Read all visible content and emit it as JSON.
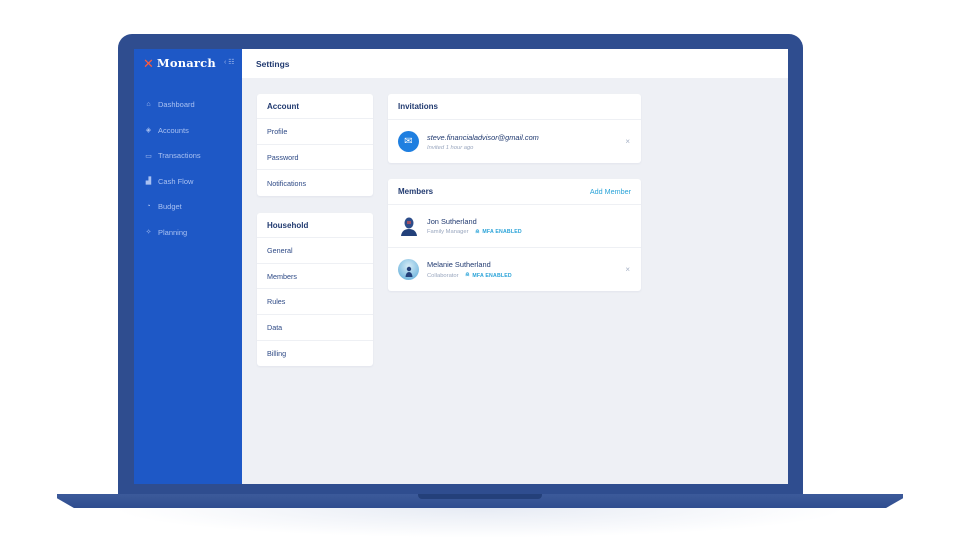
{
  "app": {
    "brand": "Monarch",
    "brand_logo_color": "#ff5a3c",
    "sidebar_color": "#1e58c6",
    "accent_color": "#2aa3d8"
  },
  "sidebar": {
    "collapse_icon": "collapse-icon",
    "items": [
      {
        "label": "Dashboard",
        "icon": "home-icon"
      },
      {
        "label": "Accounts",
        "icon": "layers-icon"
      },
      {
        "label": "Transactions",
        "icon": "card-icon"
      },
      {
        "label": "Cash Flow",
        "icon": "bar-chart-icon"
      },
      {
        "label": "Budget",
        "icon": "pie-icon"
      },
      {
        "label": "Planning",
        "icon": "spark-icon"
      }
    ]
  },
  "header": {
    "title": "Settings"
  },
  "account_menu": {
    "title": "Account",
    "items": [
      "Profile",
      "Password",
      "Notifications"
    ]
  },
  "household_menu": {
    "title": "Household",
    "items": [
      "General",
      "Members",
      "Rules",
      "Data",
      "Billing"
    ]
  },
  "invitations": {
    "title": "Invitations",
    "items": [
      {
        "email": "steve.financialadvisor@gmail.com",
        "status": "Invited 1 hour ago"
      }
    ]
  },
  "members": {
    "title": "Members",
    "add_label": "Add Member",
    "items": [
      {
        "name": "Jon Sutherland",
        "role": "Family Manager",
        "badge": "MFA ENABLED",
        "removable": false
      },
      {
        "name": "Melanie Sutherland",
        "role": "Collaborator",
        "badge": "MFA ENABLED",
        "removable": true
      }
    ]
  },
  "icons": {
    "close": "×",
    "lock": "🔒"
  }
}
